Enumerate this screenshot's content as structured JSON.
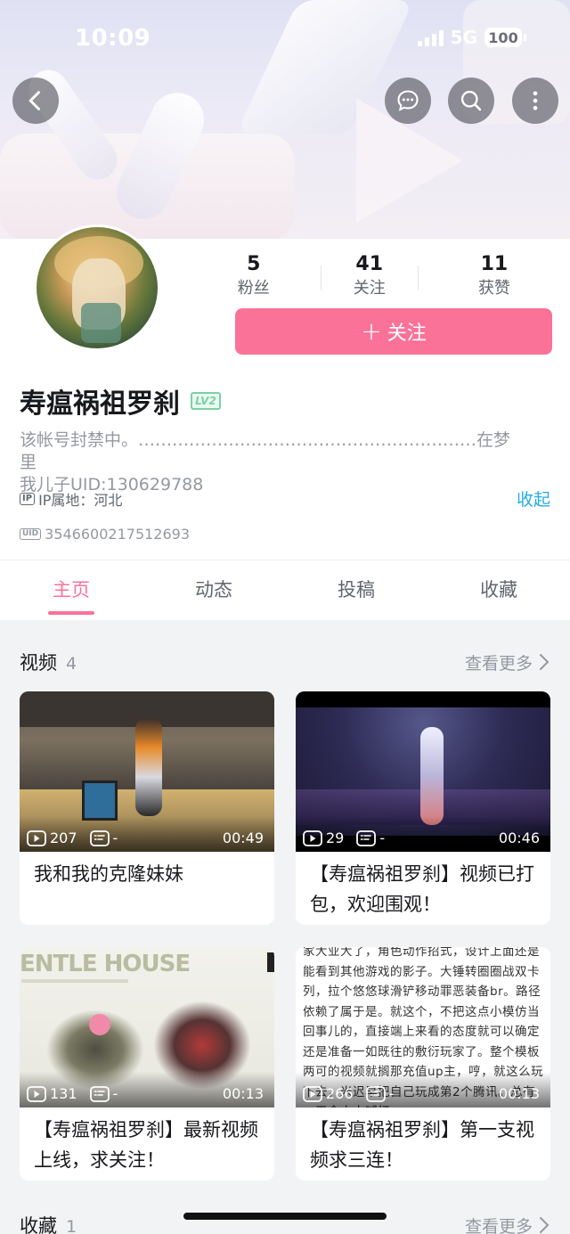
{
  "status_bar": {
    "time": "10:09",
    "network": "5G",
    "battery": "100"
  },
  "header": {
    "back_icon": "chevron-left-icon",
    "message_icon": "chat-bubble-icon",
    "search_icon": "search-icon",
    "more_icon": "more-vertical-icon"
  },
  "profile": {
    "stats": [
      {
        "value": "5",
        "label": "粉丝"
      },
      {
        "value": "41",
        "label": "关注"
      },
      {
        "value": "11",
        "label": "获赞"
      }
    ],
    "follow_button": "关注",
    "username": "寿瘟祸祖罗刹",
    "level": "LV2",
    "bio": "该帐号封禁中。……………………………………………………在梦里\n我儿子UID:130629788",
    "ip_tag": "IP",
    "ip_location": "IP属地：河北",
    "collapse": "收起",
    "uid_tag": "UID",
    "uid": "3546600217512693"
  },
  "tabs": [
    {
      "label": "主页",
      "active": true
    },
    {
      "label": "动态",
      "active": false
    },
    {
      "label": "投稿",
      "active": false
    },
    {
      "label": "收藏",
      "active": false
    }
  ],
  "videos_section": {
    "title": "视频",
    "count": "4",
    "see_more": "查看更多"
  },
  "videos": [
    {
      "plays": "207",
      "danmaku": "-",
      "duration": "00:49",
      "title": "我和我的克隆妹妹"
    },
    {
      "plays": "29",
      "danmaku": "-",
      "duration": "00:46",
      "title": "【寿瘟祸祖罗刹】视频已打包，欢迎围观！"
    },
    {
      "plays": "131",
      "danmaku": "-",
      "duration": "00:13",
      "title": "【寿瘟祸祖罗刹】最新视频上线，求关注！",
      "thumb_text": "ENTLE HOUSE"
    },
    {
      "plays": "266",
      "danmaku": "-",
      "duration": "00:13",
      "title": "【寿瘟祸祖罗刹】第一支视频求三连！",
      "thumb_text": "家大业大了，角色动作招式，设计上面还是\n能看到其他游戏的影子。大锤转圈圈战双卡\n列，拉个悠悠球滑铲移动罪恶装备br。路径\n依赖了属于是。就这个，不把这点小模仿当\n回事儿的，直接端上来看的态度就可以确定\n还是准备一如既往的敷衍玩家了。整个模板\n两可的视频就搁那充值up主，哼，就这么玩\n下去，米迟早把自己玩成第2个腾讯。总有\n一天会人人喊打。"
    }
  ],
  "favorites_section": {
    "title": "收藏",
    "count": "1",
    "see_more": "查看更多"
  }
}
